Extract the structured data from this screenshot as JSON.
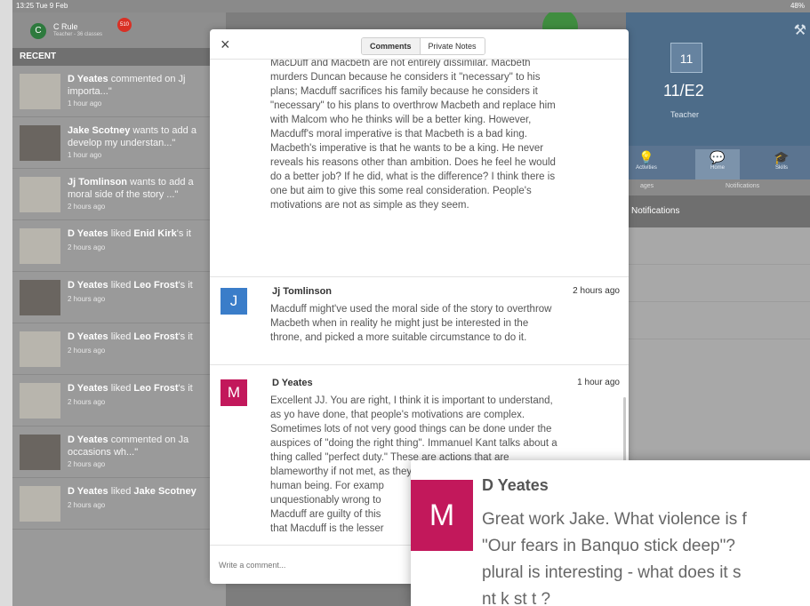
{
  "status_bar": {
    "time": "13:25  Tue 9 Feb",
    "battery": "48%"
  },
  "user": {
    "initial": "C",
    "name": "C Rule",
    "role": "Teacher - 36 classes",
    "badge": "510"
  },
  "recent": {
    "header": "RECENT",
    "items": [
      {
        "author": "D Yeates",
        "text": " commented on Jj",
        "line2": "importa...\"",
        "time": "1 hour ago"
      },
      {
        "author": "Jake Scotney",
        "text": " wants to add a",
        "line2": "develop my understan...\"",
        "time": "1 hour ago"
      },
      {
        "author": "Jj Tomlinson",
        "text": " wants to add a",
        "line2": "moral side of the story ...\"",
        "time": "2 hours ago"
      },
      {
        "author": "D Yeates",
        "text": " liked ",
        "bold2": "Enid Kirk",
        "rest": "'s it",
        "time": "2 hours ago"
      },
      {
        "author": "D Yeates",
        "text": " liked ",
        "bold2": "Leo Frost",
        "rest": "'s it",
        "time": "2 hours ago"
      },
      {
        "author": "D Yeates",
        "text": " liked ",
        "bold2": "Leo Frost",
        "rest": "'s it",
        "time": "2 hours ago"
      },
      {
        "author": "D Yeates",
        "text": " liked ",
        "bold2": "Leo Frost",
        "rest": "'s it",
        "time": "2 hours ago"
      },
      {
        "author": "D Yeates",
        "text": " commented on Ja",
        "line2": "occasions wh...\"",
        "time": "2 hours ago"
      },
      {
        "author": "D Yeates",
        "text": " liked ",
        "bold2": "Jake Scotney",
        "rest": "",
        "time": "2 hours ago"
      }
    ]
  },
  "right_panel": {
    "class_number": "11",
    "class_name": "11/E2",
    "role": "Teacher",
    "tabs": [
      "Activities",
      "Home",
      "Skills"
    ],
    "segments": [
      "ages",
      "Notifications"
    ],
    "notifications_label": "Notifications"
  },
  "modal": {
    "tabs": {
      "comments": "Comments",
      "private_notes": "Private Notes"
    },
    "close_glyph": "×",
    "first_paragraph": [
      "MacDuff and Macbeth are not entirely dissimilar. Macbeth",
      "murders Duncan because he considers it \"necessary\" to his",
      "plans; Macduff sacrifices his family because he considers it",
      "\"necessary\" to his plans to overthrow Macbeth and replace him",
      "with Malcom who he thinks will be a better king. However,",
      "Macduff's moral imperative is that Macbeth is a bad king.",
      "Macbeth's imperative is that he wants to be a king. He never",
      "reveals his reasons other than ambition. Does he feel he would",
      "do a better job? If he did, what is the difference? I think there is",
      "one but aim to give this some real consideration. People's",
      "motivations are not as simple as they seem."
    ],
    "comments": [
      {
        "initial": "J",
        "author": "Jj Tomlinson",
        "time": "2 hours ago",
        "color": "#3a7dc9",
        "lines": [
          "Macduff might've used the moral side of the story to overthrow",
          "Macbeth when in reality he might just be interested in the",
          "throne, and picked a more suitable circumstance to do it."
        ]
      },
      {
        "initial": "M",
        "author": "D Yeates",
        "time": "1 hour ago",
        "color": "#c2185b",
        "lines": [
          "Excellent JJ. You are right, I think it is important to understand,",
          "as yo have done, that people's motivations are complex.",
          "Sometimes lots of not very good things can be done under the",
          "auspices of \"doing the right thing\". Immanuel Kant talks about a",
          "thing called \"perfect duty.\" These are actions that are",
          "blameworthy if not met, as they are a basic required duty for a",
          "human being. For examp",
          "unquestionably wrong to",
          "Macduff are guilty of this",
          "that Macduff is the lesser"
        ]
      }
    ],
    "compose_placeholder": "Write a comment..."
  },
  "zoom_inset": {
    "initial": "M",
    "author": "D Yeates",
    "lines": [
      "Great work Jake. What violence is f",
      "\"Our fears in Banquo stick deep\"?",
      "plural is interesting - what does it s",
      "nt k st t ?"
    ]
  },
  "colors": {
    "accent_blue": "#4d6c89",
    "avatar_blue": "#3a7dc9",
    "avatar_magenta": "#c2185b",
    "badge_red": "#d93025"
  }
}
